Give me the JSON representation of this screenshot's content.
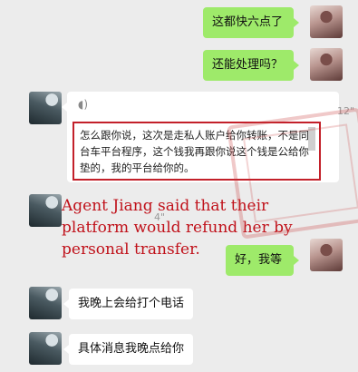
{
  "messages": {
    "outgoing_1": "这都快六点了",
    "outgoing_2": "还能处理吗？",
    "voice_duration": "12\"",
    "voice_icon": "voice-wave-icon",
    "transcript": "怎么跟你说，这次是走私人账户给你转账，不是同台车平台程序，这个钱我再跟你说这个钱是公给你垫的，我的平台给你的。",
    "voice2_duration": "4\"",
    "outgoing_3": "好，我等",
    "incoming_call": "我晚上会给打个电话",
    "incoming_details": "具体消息我晚点给你"
  },
  "annotation": {
    "text": "Agent Jiang said that their platform would refund her by personal transfer.",
    "color": "#c0111a"
  },
  "colors": {
    "outgoing_bubble": "#9eea6a",
    "incoming_bubble": "#ffffff",
    "highlight_border": "#c3202a",
    "background": "#ececec"
  }
}
